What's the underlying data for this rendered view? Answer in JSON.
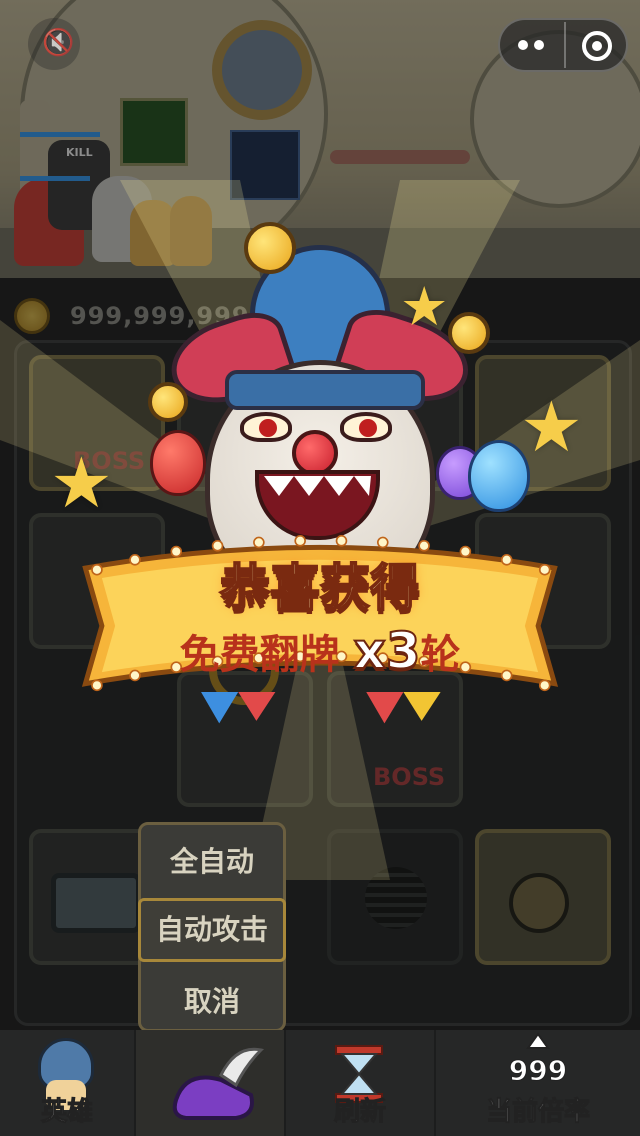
{
  "resources": {
    "coins": "999,999,999"
  },
  "reward_popup": {
    "title": "恭喜获得",
    "subtitle": "免费翻牌",
    "multiplier": "x3",
    "rounds_suffix": "轮"
  },
  "board": {
    "boss_label": "BOSS"
  },
  "auto_menu": {
    "items": [
      "全自动",
      "自动攻击",
      "取消"
    ]
  },
  "bottom_bar": {
    "hero_label": "英雄",
    "refresh_label": "刷新",
    "multiplier_value": "999",
    "multiplier_label": "当前倍率"
  },
  "heroes": {
    "head_tag": "KILL"
  },
  "icons": [
    "mute-icon",
    "more-icon",
    "close-icon",
    "coin-icon",
    "hero-icon",
    "winged-shoe-icon",
    "hourglass-icon",
    "arrow-up-icon",
    "treasure-chest-icon",
    "potion-icon",
    "gear-wheel-icon"
  ],
  "colors": {
    "banner": "#f6b53a",
    "banner_text": "#fff6b8",
    "accent_red": "#d03e56",
    "hat_blue": "#3d7fc0"
  }
}
